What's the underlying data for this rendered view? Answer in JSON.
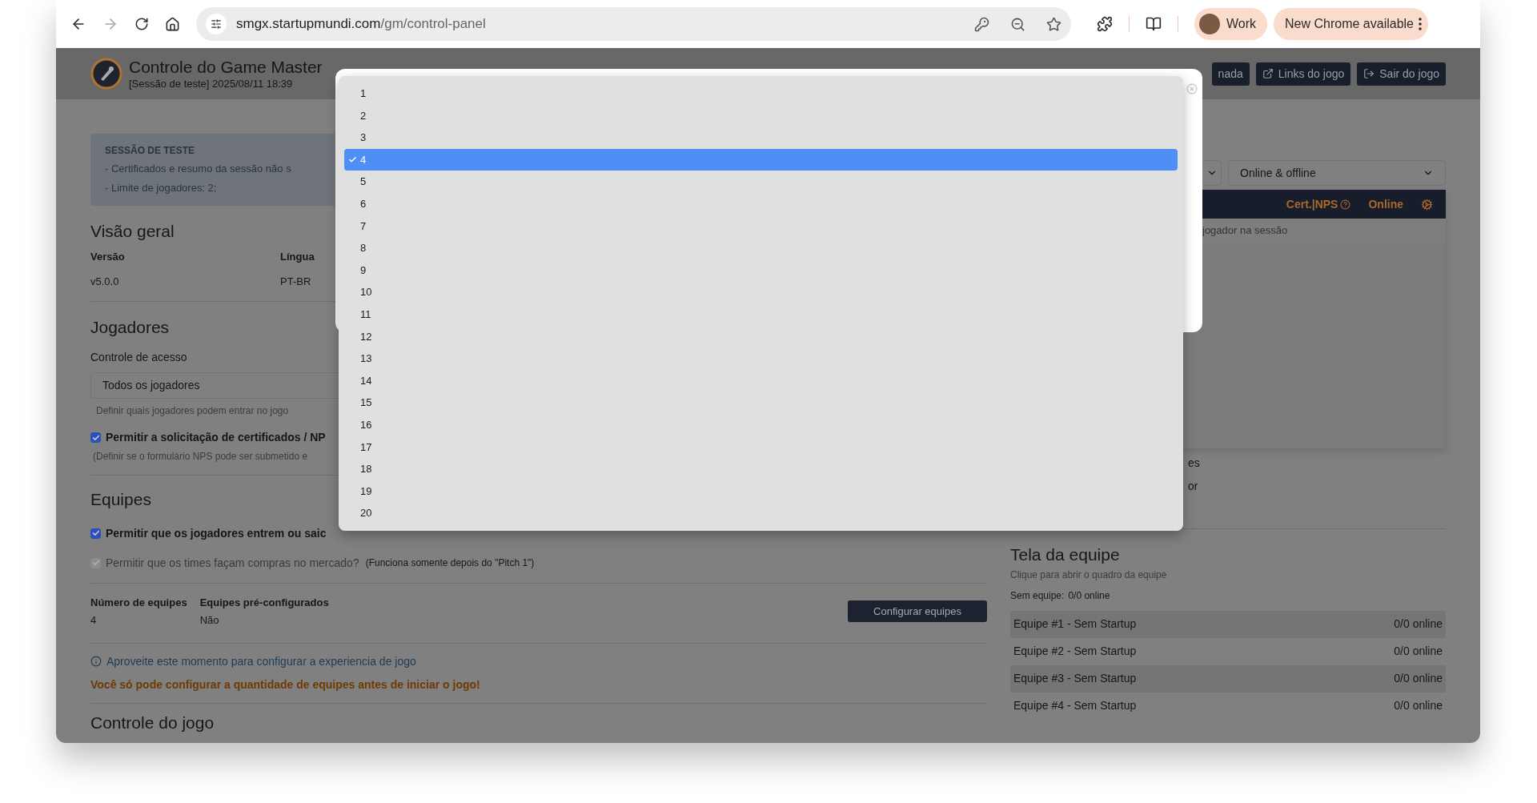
{
  "browser": {
    "url_host": "smgx.startupmundi.com",
    "url_path": "/gm/control-panel",
    "profile": "Work",
    "update_button": "New Chrome available"
  },
  "header": {
    "title": "Controle do Game Master",
    "subtitle": "[Sessão de teste] 2025/08/11 18:39",
    "buttons": [
      {
        "label": "nada",
        "kind": "plain"
      },
      {
        "label": "Links do jogo",
        "kind": "link"
      },
      {
        "label": "Sair do jogo",
        "kind": "exit"
      }
    ]
  },
  "notice": {
    "title": "SESSÃO DE TESTE",
    "lines": [
      "- Certificados e resumo da sessão não s",
      "- Limite de jogadores: 2;"
    ]
  },
  "overview": {
    "heading": "Visão geral",
    "fields": [
      {
        "label": "Versão",
        "value": "v5.0.0"
      },
      {
        "label": "Língua",
        "value": "PT-BR"
      }
    ]
  },
  "players": {
    "heading": "Jogadores",
    "access_label": "Controle de acesso",
    "access_value": "Todos os jogadores",
    "access_hint": "Definir quais jogadores podem entrar no jogo",
    "options": [
      {
        "label": "Permitir a solicitação de certificados / NP",
        "hint": "(Definir se o formulário NPS pode ser submetido e",
        "checked": true,
        "disabled": false
      }
    ]
  },
  "teams": {
    "heading": "Equipes",
    "options": [
      {
        "label": "Permitir que os jogadores entrem ou saic",
        "checked": true,
        "disabled": false
      },
      {
        "label": "Permitir que os times façam compras no mercado?",
        "note": "(Funciona somente depois do \"Pitch 1\")",
        "checked": true,
        "disabled": true
      }
    ],
    "fields": [
      {
        "label": "Número de equipes",
        "value": "4"
      },
      {
        "label": "Equipes pré-configurados",
        "value": "Não"
      }
    ],
    "configure_button": "Configurar equipes",
    "info": "Aproveite este momento para configurar a experiencia de jogo",
    "warning": "Você só pode configurar a quantidade de equipes antes de iniciar o jogo!"
  },
  "game_control": {
    "heading": "Controle do jogo"
  },
  "players_panel": {
    "filter": "Online & offline",
    "columns": [
      {
        "label": "Cert.|NPS",
        "kind": "help"
      },
      {
        "label": "Online",
        "kind": "plain"
      }
    ],
    "empty_row": "jogador na sessão",
    "fragments": [
      "es",
      "or"
    ]
  },
  "team_screen": {
    "heading": "Tela da equipe",
    "subtitle": "Clique para abrir o quadro da equipe",
    "no_team_label": "Sem equipe:",
    "no_team_value": "0/0 online",
    "teams": [
      {
        "name": "Equipe #1 - Sem Startup",
        "status": "0/0 online"
      },
      {
        "name": "Equipe #2 - Sem Startup",
        "status": "0/0 online"
      },
      {
        "name": "Equipe #3 - Sem Startup",
        "status": "0/0 online"
      },
      {
        "name": "Equipe #4 - Sem Startup",
        "status": "0/0 online"
      }
    ]
  },
  "dropdown": {
    "options": [
      {
        "label": "1",
        "selected": false
      },
      {
        "label": "2",
        "selected": false
      },
      {
        "label": "3",
        "selected": false
      },
      {
        "label": "4",
        "selected": true
      },
      {
        "label": "5",
        "selected": false
      },
      {
        "label": "6",
        "selected": false
      },
      {
        "label": "7",
        "selected": false
      },
      {
        "label": "8",
        "selected": false
      },
      {
        "label": "9",
        "selected": false
      },
      {
        "label": "10",
        "selected": false
      },
      {
        "label": "11",
        "selected": false
      },
      {
        "label": "12",
        "selected": false
      },
      {
        "label": "13",
        "selected": false
      },
      {
        "label": "14",
        "selected": false
      },
      {
        "label": "15",
        "selected": false
      },
      {
        "label": "16",
        "selected": false
      },
      {
        "label": "17",
        "selected": false
      },
      {
        "label": "18",
        "selected": false
      },
      {
        "label": "19",
        "selected": false
      },
      {
        "label": "20",
        "selected": false
      }
    ]
  }
}
